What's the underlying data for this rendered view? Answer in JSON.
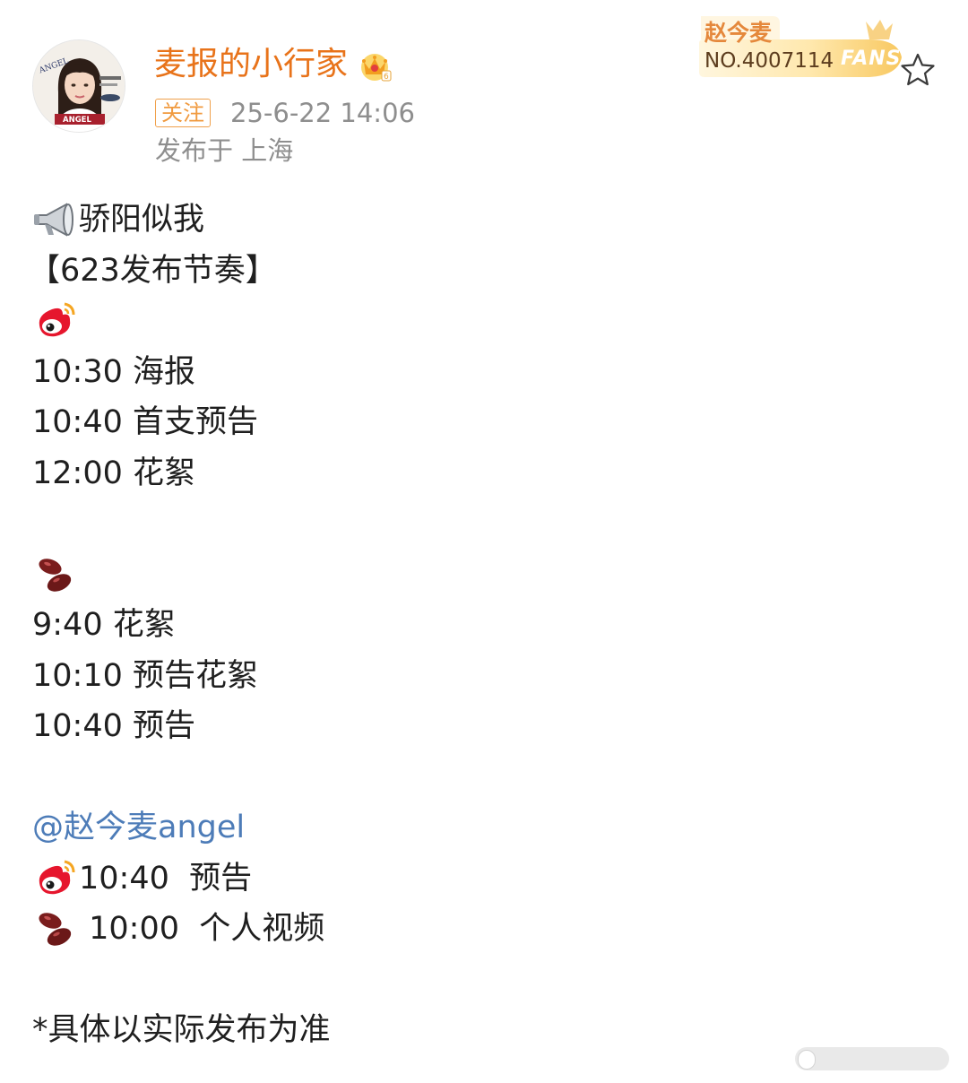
{
  "post": {
    "author": {
      "name": "麦报的小行家",
      "badge_icon": "crown-vip-icon"
    },
    "follow_label": "关注",
    "timestamp": "25-6-22 14:06",
    "location": "发布于 上海",
    "fans_badge": {
      "name": "赵今麦",
      "number": "NO.4007114",
      "word": "FANS"
    },
    "lines": [
      {
        "icon": "megaphone-icon",
        "text": "骄阳似我"
      },
      {
        "icon": null,
        "text": "【623发布节奏】"
      },
      {
        "icon": "weibo-icon",
        "text": ""
      },
      {
        "icon": null,
        "text": "10:30 海报"
      },
      {
        "icon": null,
        "text": "10:40 首支预告"
      },
      {
        "icon": null,
        "text": "12:00 花絮"
      },
      {
        "icon": null,
        "text": ""
      },
      {
        "icon": "beans-icon",
        "text": ""
      },
      {
        "icon": null,
        "text": "9:40 花絮"
      },
      {
        "icon": null,
        "text": "10:10 预告花絮"
      },
      {
        "icon": null,
        "text": "10:40 预告"
      },
      {
        "icon": null,
        "text": ""
      },
      {
        "icon": null,
        "text": "@赵今麦angel"
      },
      {
        "icon": "weibo-icon",
        "text": "10:40  预告"
      },
      {
        "icon": "beans-icon",
        "text": " 10:00  个人视频"
      },
      {
        "icon": null,
        "text": ""
      },
      {
        "icon": null,
        "text": "*具体以实际发布为准"
      }
    ]
  },
  "colors": {
    "username": "#e8731a",
    "follow_tag": "#f09a3f",
    "meta_text": "#8e8e8e",
    "mention": "#4d7cb8",
    "body_text": "#1f1f1f"
  },
  "icons": {
    "favorite": "star-outline-icon",
    "avatar": "avatar"
  }
}
